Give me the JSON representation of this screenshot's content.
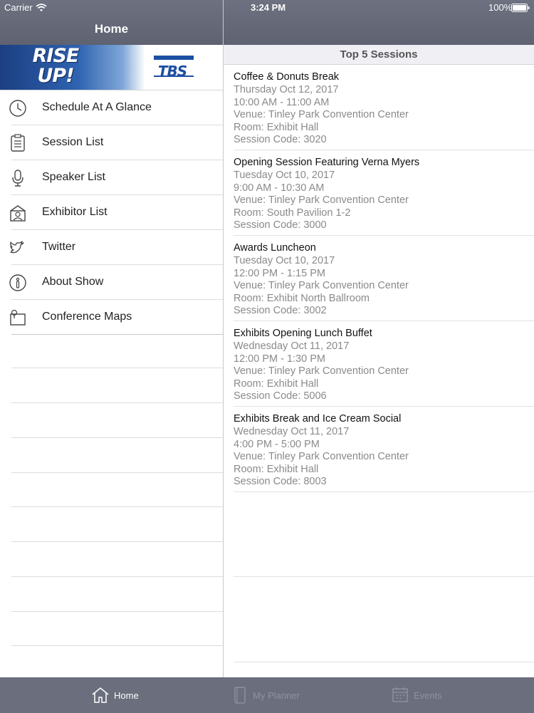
{
  "status_bar": {
    "carrier": "Carrier",
    "time": "3:24 PM",
    "battery": "100%"
  },
  "nav": {
    "title": "Home"
  },
  "banner": {
    "rise_line1": "RISE",
    "rise_line2": "UP!",
    "tbs": "TBS"
  },
  "menu": {
    "items": [
      {
        "label": "Schedule At A Glance",
        "icon": "clock-icon"
      },
      {
        "label": "Session List",
        "icon": "clipboard-icon"
      },
      {
        "label": "Speaker List",
        "icon": "microphone-icon"
      },
      {
        "label": "Exhibitor List",
        "icon": "exhibitor-icon"
      },
      {
        "label": "Twitter",
        "icon": "twitter-icon"
      },
      {
        "label": "About Show",
        "icon": "info-icon"
      },
      {
        "label": "Conference Maps",
        "icon": "map-icon"
      }
    ]
  },
  "sessions": {
    "title": "Top 5 Sessions",
    "items": [
      {
        "title": "Coffee & Donuts Break",
        "date": "Thursday Oct 12, 2017",
        "time": "10:00 AM - 11:00 AM",
        "venue": "Venue: Tinley Park Convention Center",
        "room": "Room: Exhibit Hall",
        "code": "Session Code: 3020"
      },
      {
        "title": "Opening Session Featuring Verna Myers",
        "date": "Tuesday Oct 10, 2017",
        "time": "9:00 AM - 10:30 AM",
        "venue": "Venue: Tinley Park Convention Center",
        "room": "Room: South Pavilion 1-2",
        "code": "Session Code: 3000"
      },
      {
        "title": "Awards Luncheon",
        "date": "Tuesday Oct 10, 2017",
        "time": "12:00 PM - 1:15 PM",
        "venue": "Venue: Tinley Park Convention Center",
        "room": "Room: Exhibit North Ballroom",
        "code": "Session Code: 3002"
      },
      {
        "title": "Exhibits Opening Lunch Buffet",
        "date": "Wednesday Oct 11, 2017",
        "time": "12:00 PM - 1:30 PM",
        "venue": "Venue: Tinley Park Convention Center",
        "room": "Room: Exhibit Hall",
        "code": "Session Code: 5006"
      },
      {
        "title": "Exhibits Break and Ice Cream Social",
        "date": "Wednesday Oct 11, 2017",
        "time": "4:00 PM - 5:00 PM",
        "venue": "Venue: Tinley Park Convention Center",
        "room": "Room: Exhibit Hall",
        "code": "Session Code: 8003"
      }
    ]
  },
  "tabs": [
    {
      "label": "Home",
      "icon": "home-icon",
      "active": true
    },
    {
      "label": "My Planner",
      "icon": "planner-icon",
      "active": false
    },
    {
      "label": "Events",
      "icon": "calendar-icon",
      "active": false
    }
  ],
  "colors": {
    "bar": "#6a6e7d",
    "accent_blue": "#1d4fa3"
  }
}
